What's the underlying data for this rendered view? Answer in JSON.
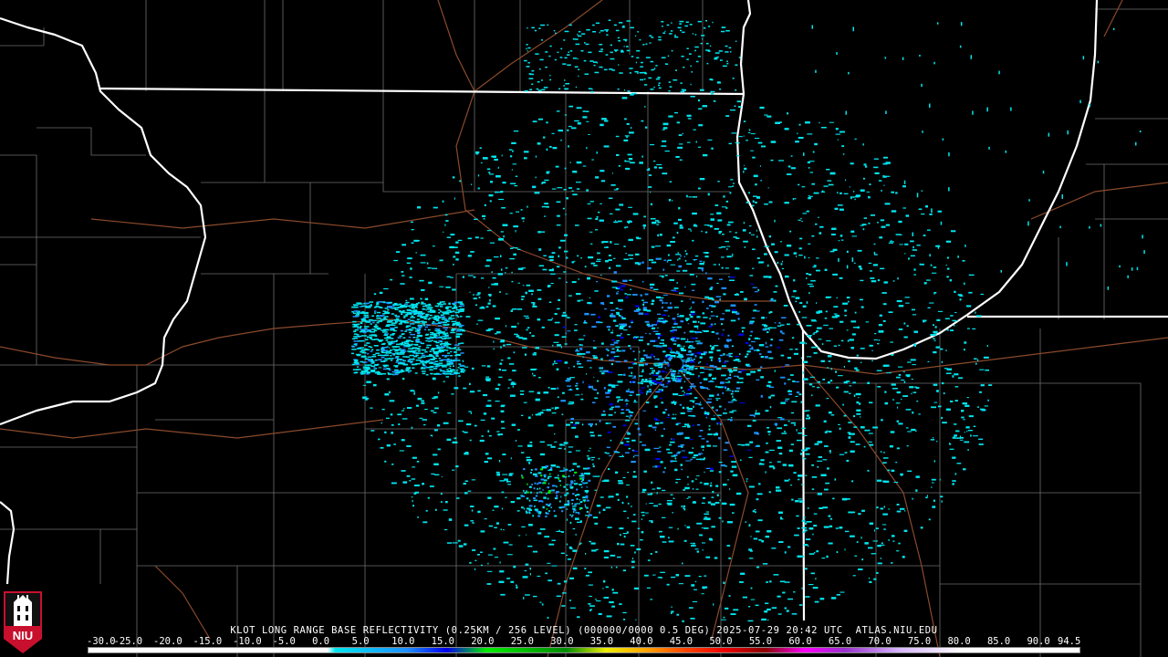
{
  "product": {
    "caption": "KLOT LONG RANGE BASE REFLECTIVITY (0.25KM / 256 LEVEL) (000000/0000 0.5 DEG) 2025-07-29 20:42 UTC  ATLAS.NIU.EDU"
  },
  "legend": {
    "unit_values": [
      "-30.0",
      "-25.0",
      "-20.0",
      "-15.0",
      "-10.0",
      "-5.0",
      "0.0",
      "5.0",
      "10.0",
      "15.0",
      "20.0",
      "25.0",
      "30.0",
      "35.0",
      "40.0",
      "45.0",
      "50.0",
      "55.0",
      "60.0",
      "65.0",
      "70.0",
      "75.0",
      "80.0",
      "85.0",
      "90.0",
      "94.5"
    ],
    "color_stops": [
      {
        "dbz": -30,
        "color": "#ffffff"
      },
      {
        "dbz": 0,
        "color": "#ffffff"
      },
      {
        "dbz": 1,
        "color": "#00e5ee"
      },
      {
        "dbz": 10,
        "color": "#1e90ff"
      },
      {
        "dbz": 15,
        "color": "#0000ee"
      },
      {
        "dbz": 20,
        "color": "#00ee00"
      },
      {
        "dbz": 30,
        "color": "#008b00"
      },
      {
        "dbz": 35,
        "color": "#eeee00"
      },
      {
        "dbz": 40,
        "color": "#ffa500"
      },
      {
        "dbz": 45,
        "color": "#ff4500"
      },
      {
        "dbz": 50,
        "color": "#ee0000"
      },
      {
        "dbz": 55,
        "color": "#8b0000"
      },
      {
        "dbz": 60,
        "color": "#ff00ff"
      },
      {
        "dbz": 65,
        "color": "#9932cc"
      },
      {
        "dbz": 72,
        "color": "#d8b8ff"
      },
      {
        "dbz": 80,
        "color": "#ffffff"
      },
      {
        "dbz": 94.5,
        "color": "#ffffff"
      }
    ]
  },
  "map": {
    "background_color": "#000000",
    "state_border_color": "#ffffff",
    "county_line_color": "#6e6e6e",
    "highway_color": "#8b4a2b",
    "echo_colors": [
      "#00e5ee",
      "#1e90ff",
      "#0000ee",
      "#00ee00"
    ]
  },
  "logo": {
    "text": "NIU",
    "color": "#c8102e"
  }
}
